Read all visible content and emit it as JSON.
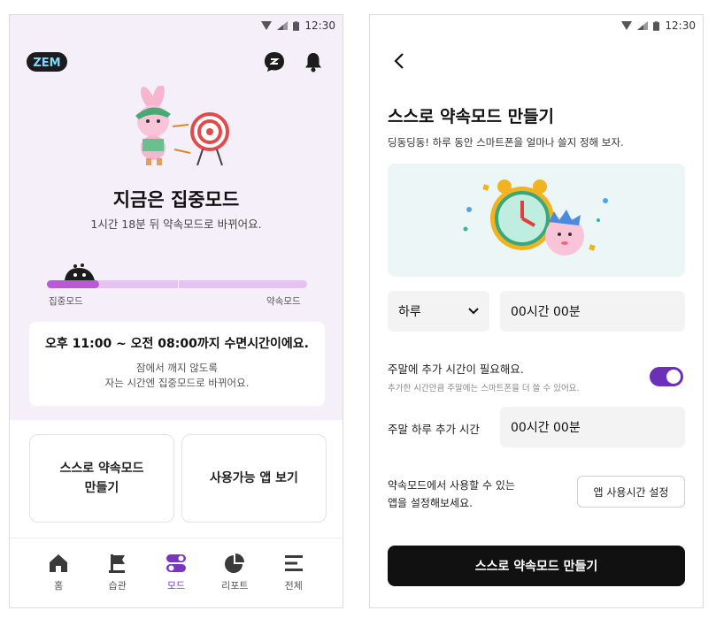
{
  "status_bar": {
    "time": "12:30"
  },
  "left": {
    "logo_text": "ZEM",
    "mode_title": "지금은 집중모드",
    "mode_subtitle": "1시간 18분 뒤 약속모드로 바뀌어요.",
    "progress": {
      "fraction": 0.2,
      "left_label": "집중모드",
      "right_label": "약속모드"
    },
    "sleep_card": {
      "title": "오후 11:00 ~ 오전 08:00까지 수면시간이에요.",
      "desc": "잠에서 깨지 않도록\n자는 시간엔 집중모드로 바뀌어요."
    },
    "actions": {
      "create": "스스로 약속모드\n만들기",
      "view_apps": "사용가능 앱 보기"
    },
    "nav": [
      {
        "label": "홈",
        "icon": "home-icon"
      },
      {
        "label": "습관",
        "icon": "flag-icon"
      },
      {
        "label": "모드",
        "icon": "mode-toggle-icon",
        "active": true
      },
      {
        "label": "리포트",
        "icon": "pie-chart-icon"
      },
      {
        "label": "전체",
        "icon": "menu-icon"
      }
    ],
    "accent_color": "#7a35c2",
    "background_color": "#f5effa"
  },
  "right": {
    "title": "스스로 약속모드 만들기",
    "subtitle": "딩동딩동! 하루 동안 스마트폰을 얼마나 쓸지 정해 보자.",
    "period_select": "하루",
    "daily_time": "00시간 00분",
    "weekend_toggle": {
      "label": "주말에 추가 시간이 필요해요.",
      "hint": "추가한 시간만큼 주말에는 스마트폰을 더 쓸 수 있어요.",
      "on": true
    },
    "weekend_extra_label": "주말 하루 추가 시간",
    "weekend_extra_time": "00시간 00분",
    "app_desc": "약속모드에서 사용할 수 있는\n앱을 설정해보세요.",
    "app_button": "앱 사용시간 설정",
    "submit_button": "스스로 약속모드 만들기",
    "toggle_color": "#6b2fb8"
  }
}
